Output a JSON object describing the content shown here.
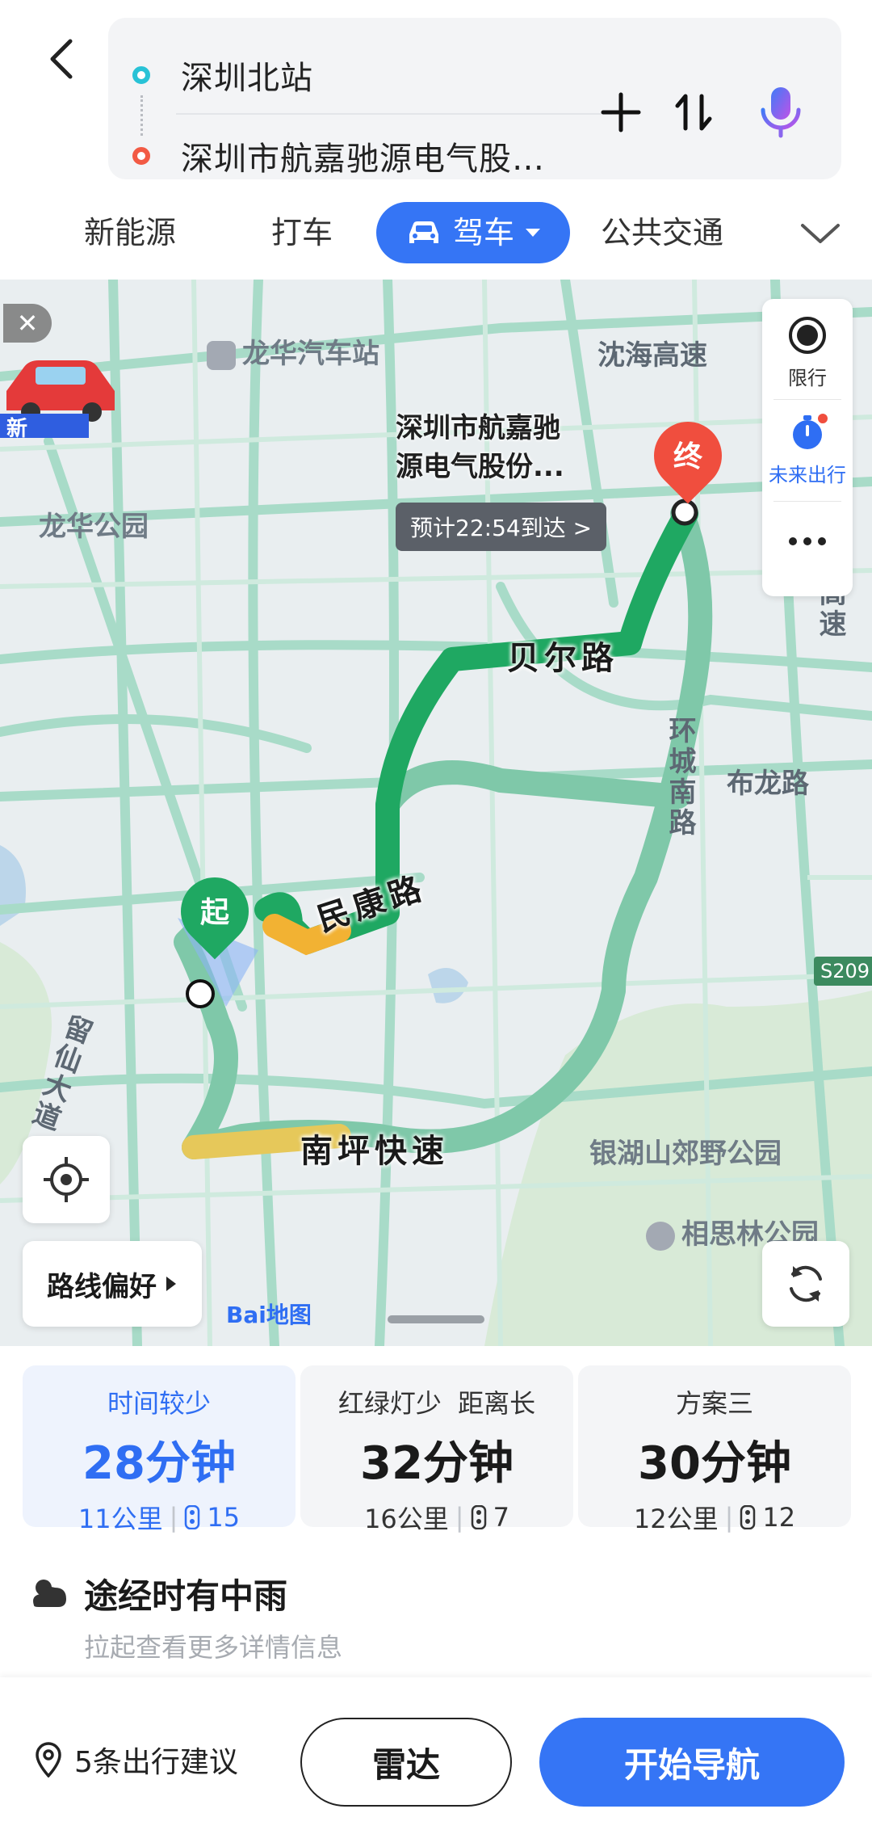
{
  "search": {
    "start": "深圳北站",
    "destination": "深圳市航嘉驰源电气股…"
  },
  "tabs": [
    "新能源",
    "打车",
    "驾车",
    "公共交通"
  ],
  "map": {
    "poi_labels": {
      "bus_station": "龙华汽车站",
      "park_longhua": "龙华公园",
      "park_yinhu": "银湖山郊野公园",
      "park_xiangsi": "相思林公园"
    },
    "roads": {
      "shenhai": "沈海高速",
      "beier": "贝尔路",
      "minkang": "民康路",
      "huancheng": "环城南路",
      "bulong": "布龙路",
      "nanping": "南坪快速",
      "liuxian": "留仙大道",
      "s209": "S209",
      "gaosu": "高速"
    },
    "destination_name": "深圳市航嘉驰\n源电气股份...",
    "eta": "预计22:54到达 >",
    "end_pin": "终",
    "start_pin": "起",
    "promo_badge": "新",
    "side_panel": {
      "restrict": "限行",
      "future": "未来出行"
    },
    "route_pref": "路线偏好",
    "logo": "Bai地图"
  },
  "plans": [
    {
      "title": "时间较少",
      "time": "28分钟",
      "distance": "11公里",
      "lights": "15"
    },
    {
      "title": "红绿灯少  距离长",
      "time": "32分钟",
      "distance": "16公里",
      "lights": "7"
    },
    {
      "title": "方案三",
      "time": "30分钟",
      "distance": "12公里",
      "lights": "12"
    }
  ],
  "weather": {
    "text": "途经时有中雨",
    "sub": "拉起查看更多详情信息"
  },
  "actions": {
    "suggestions": "5条出行建议",
    "radar": "雷达",
    "navigate": "开始导航"
  },
  "colors": {
    "accent": "#3575f5",
    "route_green": "#1fa862",
    "route_alt": "#7fc8a9",
    "end_red": "#f04e3e"
  }
}
